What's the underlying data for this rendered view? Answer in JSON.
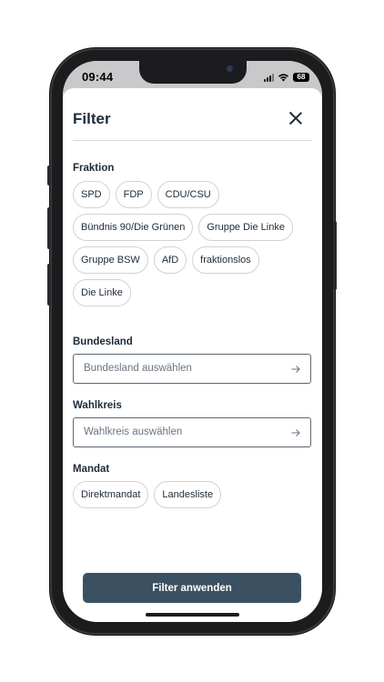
{
  "status_bar": {
    "time": "09:44",
    "battery": "68"
  },
  "filter": {
    "title": "Filter",
    "fraktion": {
      "label": "Fraktion",
      "chips": [
        "SPD",
        "FDP",
        "CDU/CSU",
        "Bündnis 90/Die Grünen",
        "Gruppe Die Linke",
        "Gruppe BSW",
        "AfD",
        "fraktionslos",
        "Die Linke"
      ]
    },
    "bundesland": {
      "label": "Bundesland",
      "placeholder": "Bundesland auswählen"
    },
    "wahlkreis": {
      "label": "Wahlkreis",
      "placeholder": "Wahlkreis auswählen"
    },
    "mandat": {
      "label": "Mandat",
      "chips": [
        "Direktmandat",
        "Landesliste"
      ]
    },
    "apply_label": "Filter anwenden"
  },
  "colors": {
    "accent": "#3b5161",
    "text": "#1c2b3a",
    "border": "#cfd3d7"
  },
  "icons": {
    "close": "close-icon",
    "arrow": "arrow-right-icon"
  }
}
